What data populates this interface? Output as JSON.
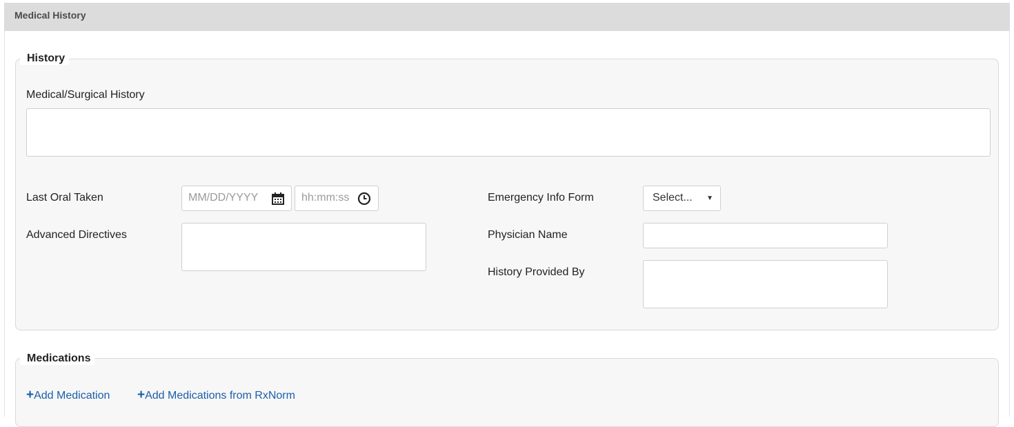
{
  "panel": {
    "title": "Medical History"
  },
  "history": {
    "legend": "History",
    "medical_surgical_label": "Medical/Surgical History",
    "medical_surgical_value": "",
    "last_oral_label": "Last Oral Taken",
    "date_placeholder": "MM/DD/YYYY",
    "time_placeholder": "hh:mm:ss",
    "advanced_directives_label": "Advanced Directives",
    "emergency_info_label": "Emergency Info Form",
    "emergency_info_selected": "Select...",
    "physician_name_label": "Physician Name",
    "history_provided_label": "History Provided By"
  },
  "medications": {
    "legend": "Medications",
    "add_medication": "Add Medication",
    "add_rxnorm": "Add Medications from RxNorm",
    "plus_glyph": "+"
  },
  "icons": {
    "calendar": "calendar-icon",
    "clock": "clock-icon",
    "caret": "caret-down-icon"
  },
  "colors": {
    "header_bg": "#dcdcdc",
    "fieldset_bg": "#f7f7f7",
    "link": "#1a5fa8"
  }
}
